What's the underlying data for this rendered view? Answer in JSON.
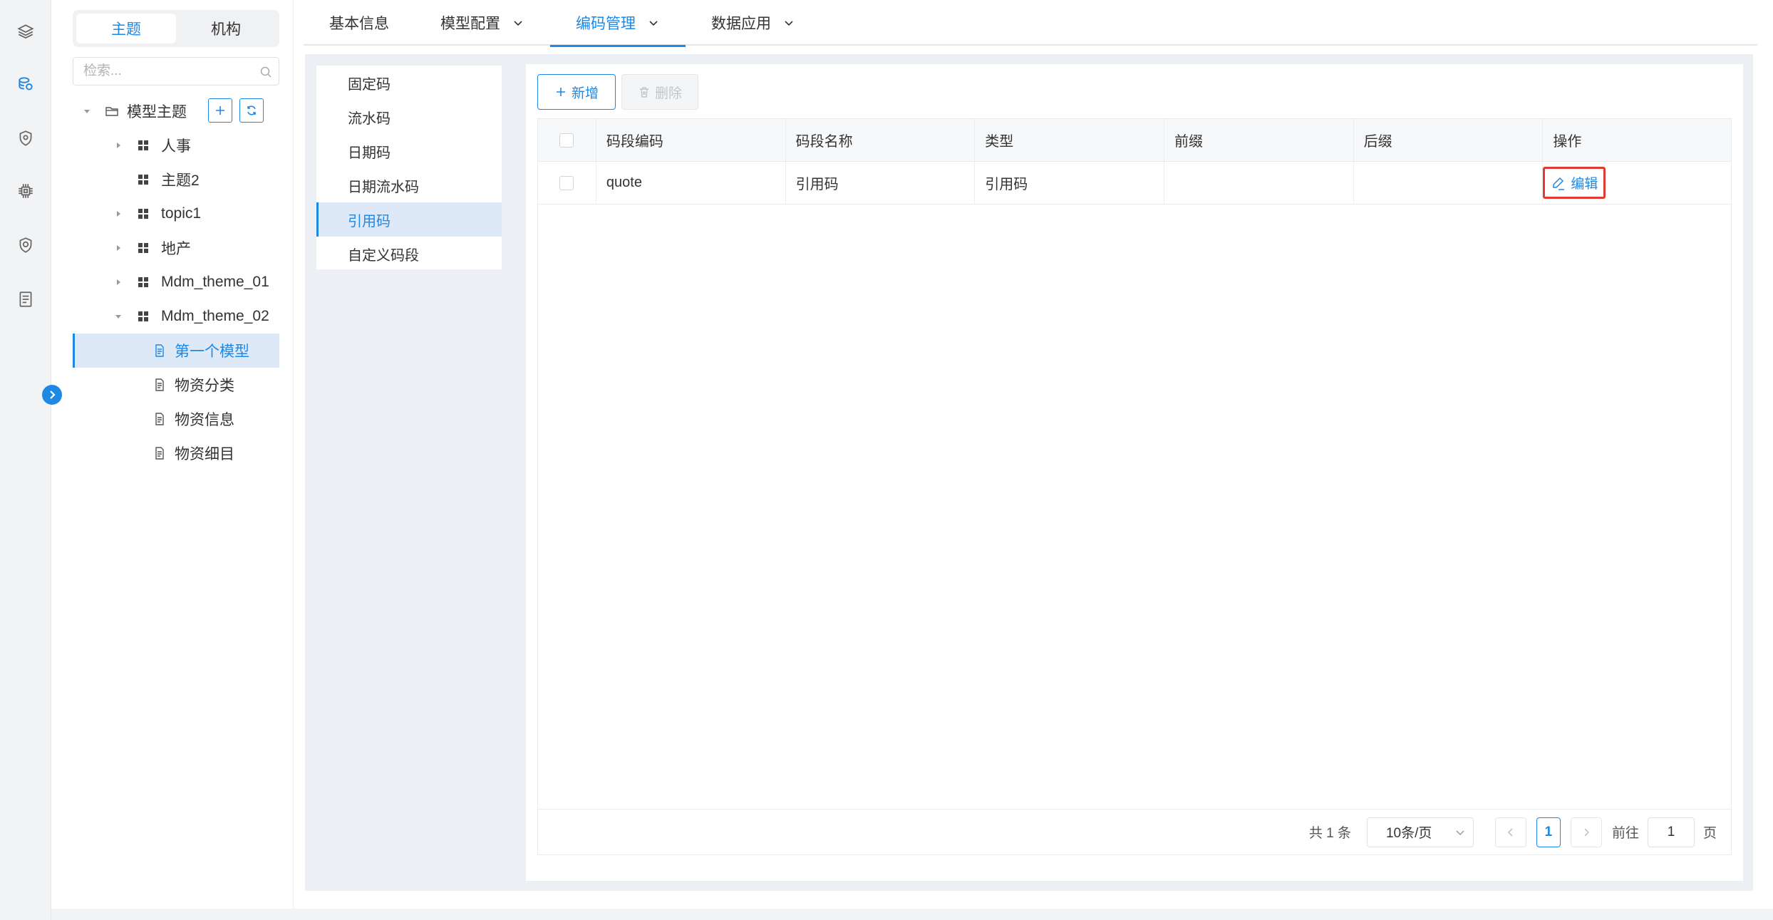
{
  "tree_tabs": {
    "topic": "主题",
    "org": "机构"
  },
  "search": {
    "placeholder": "检索..."
  },
  "tree": {
    "root_label": "模型主题",
    "items": [
      {
        "label": "人事"
      },
      {
        "label": "主题2"
      },
      {
        "label": "topic1"
      },
      {
        "label": "地产"
      },
      {
        "label": "Mdm_theme_01"
      },
      {
        "label": "Mdm_theme_02"
      }
    ],
    "models": [
      {
        "label": "第一个模型"
      },
      {
        "label": "物资分类"
      },
      {
        "label": "物资信息"
      },
      {
        "label": "物资细目"
      }
    ]
  },
  "top_tabs": [
    {
      "label": "基本信息"
    },
    {
      "label": "模型配置"
    },
    {
      "label": "编码管理"
    },
    {
      "label": "数据应用"
    }
  ],
  "subnav": [
    {
      "label": "固定码"
    },
    {
      "label": "流水码"
    },
    {
      "label": "日期码"
    },
    {
      "label": "日期流水码"
    },
    {
      "label": "引用码"
    },
    {
      "label": "自定义码段"
    }
  ],
  "toolbar": {
    "add_label": "新增",
    "delete_label": "删除"
  },
  "table": {
    "columns": [
      "码段编码",
      "码段名称",
      "类型",
      "前缀",
      "后缀",
      "操作"
    ],
    "rows": [
      {
        "code": "quote",
        "name": "引用码",
        "type": "引用码",
        "prefix": "",
        "suffix": "",
        "action": "编辑"
      }
    ]
  },
  "pagination": {
    "total_text": "共 1 条",
    "page_size": "10条/页",
    "current_page": "1",
    "goto_prefix": "前往",
    "goto_value": "1",
    "goto_suffix": "页"
  },
  "colors": {
    "accent": "#1e88e5",
    "highlight_border": "#e53935"
  }
}
